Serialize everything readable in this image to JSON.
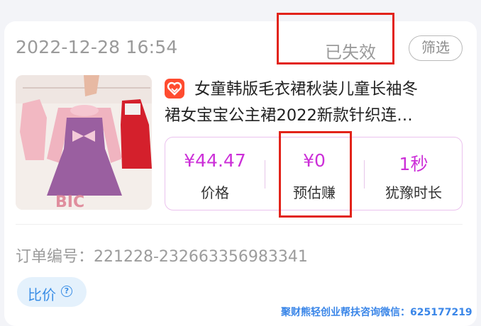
{
  "order": {
    "date": "2022-12-28 16:54",
    "status": "已失效",
    "filter_label": "筛选",
    "title_line1": "女童韩版毛衣裙秋装儿童长袖冬",
    "title_line2": "裙女宝宝公主裙2022新款针织连…",
    "stats": [
      {
        "value": "¥44.47",
        "label": "价格"
      },
      {
        "value": "¥0",
        "label": "预估赚"
      },
      {
        "value": "1秒",
        "label": "犹豫时长"
      }
    ],
    "order_number": "订单编号：221228-232663356983341",
    "compare_label": "比价",
    "help_symbol": "?"
  },
  "watermark": "聚财熊轻创业帮扶咨询微信：625177219",
  "icons": {
    "shop": "shop-heart-icon",
    "help": "question-circle-icon"
  },
  "colors": {
    "accent": "#cc2fd8",
    "highlight": "#e2231a",
    "link": "#3a8ee6"
  }
}
